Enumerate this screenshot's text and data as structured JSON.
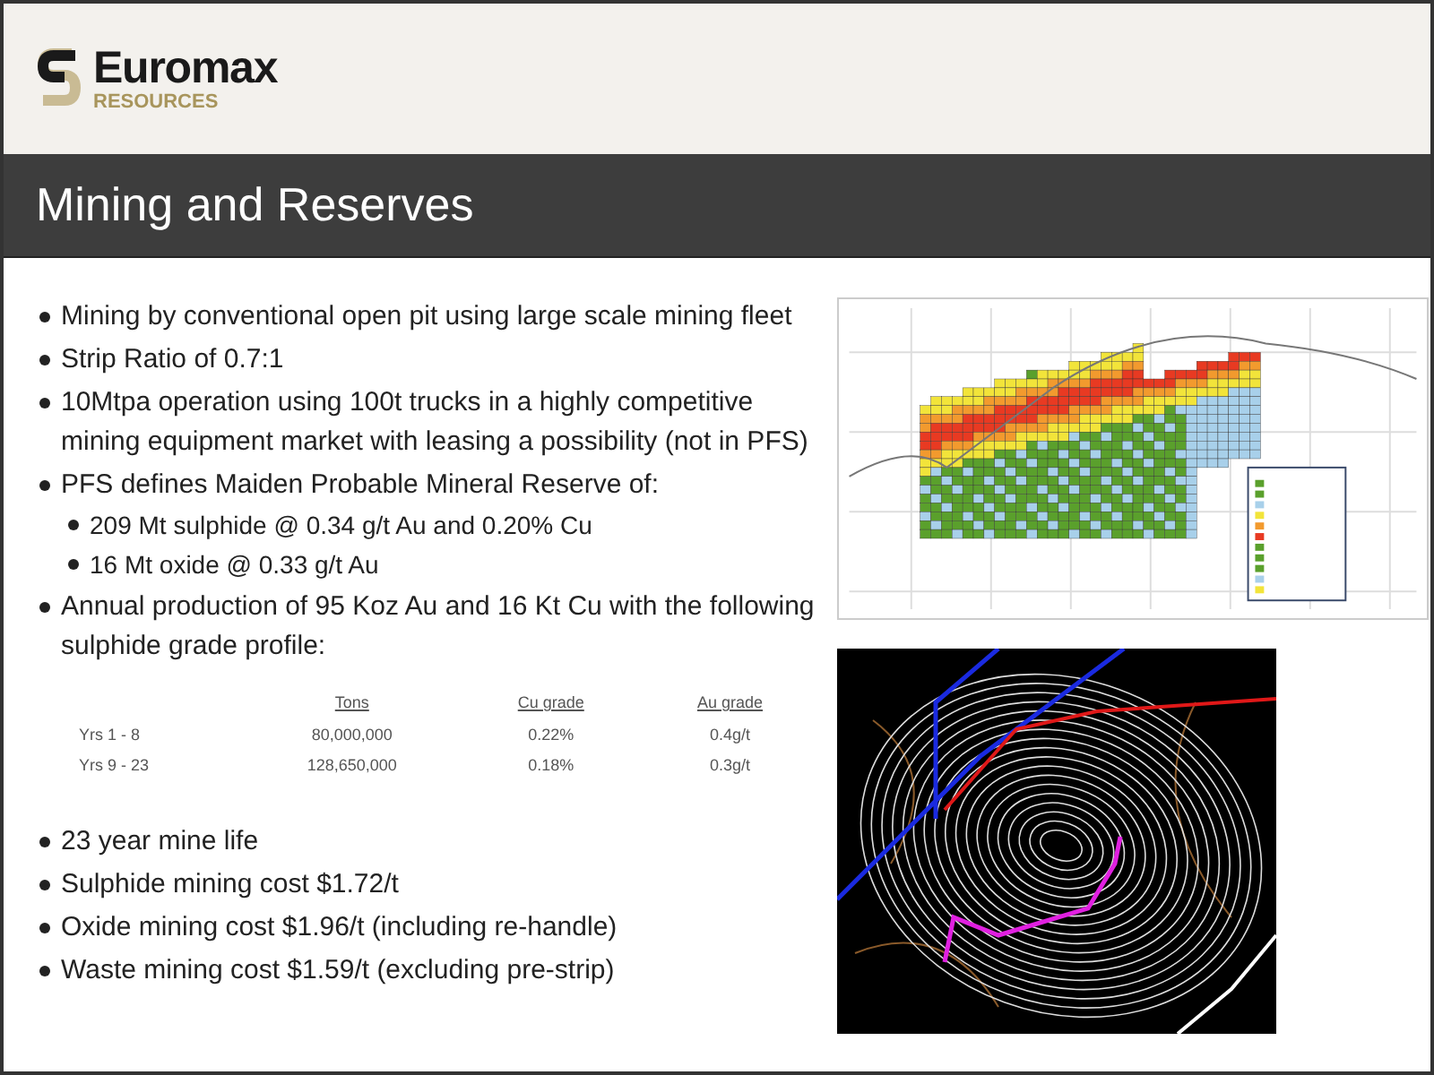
{
  "logo": {
    "name": "Euromax",
    "tagline": "RESOURCES"
  },
  "title": "Mining and Reserves",
  "bullets_top": [
    {
      "text": "Mining by conventional open pit using large scale mining fleet"
    },
    {
      "text": "Strip Ratio of 0.7:1"
    },
    {
      "text": "10Mtpa operation using 100t trucks in a highly competitive mining equipment market with leasing a possibility (not in PFS)"
    },
    {
      "text": "PFS defines Maiden Probable Mineral Reserve of:",
      "children": [
        {
          "text": "209 Mt sulphide @ 0.34 g/t Au and 0.20% Cu"
        },
        {
          "text": "16 Mt oxide @ 0.33 g/t Au"
        }
      ]
    },
    {
      "text": "Annual production of 95 Koz Au and 16 Kt Cu with the following sulphide grade profile:"
    }
  ],
  "production_table": {
    "columns": [
      "",
      "Tons",
      "Cu grade",
      "Au grade"
    ],
    "rows": [
      [
        "Yrs 1 - 8",
        "80,000,000",
        "0.22%",
        "0.4g/t"
      ],
      [
        "Yrs 9 - 23",
        "128,650,000",
        "0.18%",
        "0.3g/t"
      ]
    ]
  },
  "bullets_bottom": [
    {
      "text": "23 year mine life"
    },
    {
      "text": "Sulphide mining cost $1.72/t"
    },
    {
      "text": "Oxide mining cost $1.96/t (including re-handle)"
    },
    {
      "text": "Waste mining cost $1.59/t (excluding pre-strip)"
    }
  ]
}
